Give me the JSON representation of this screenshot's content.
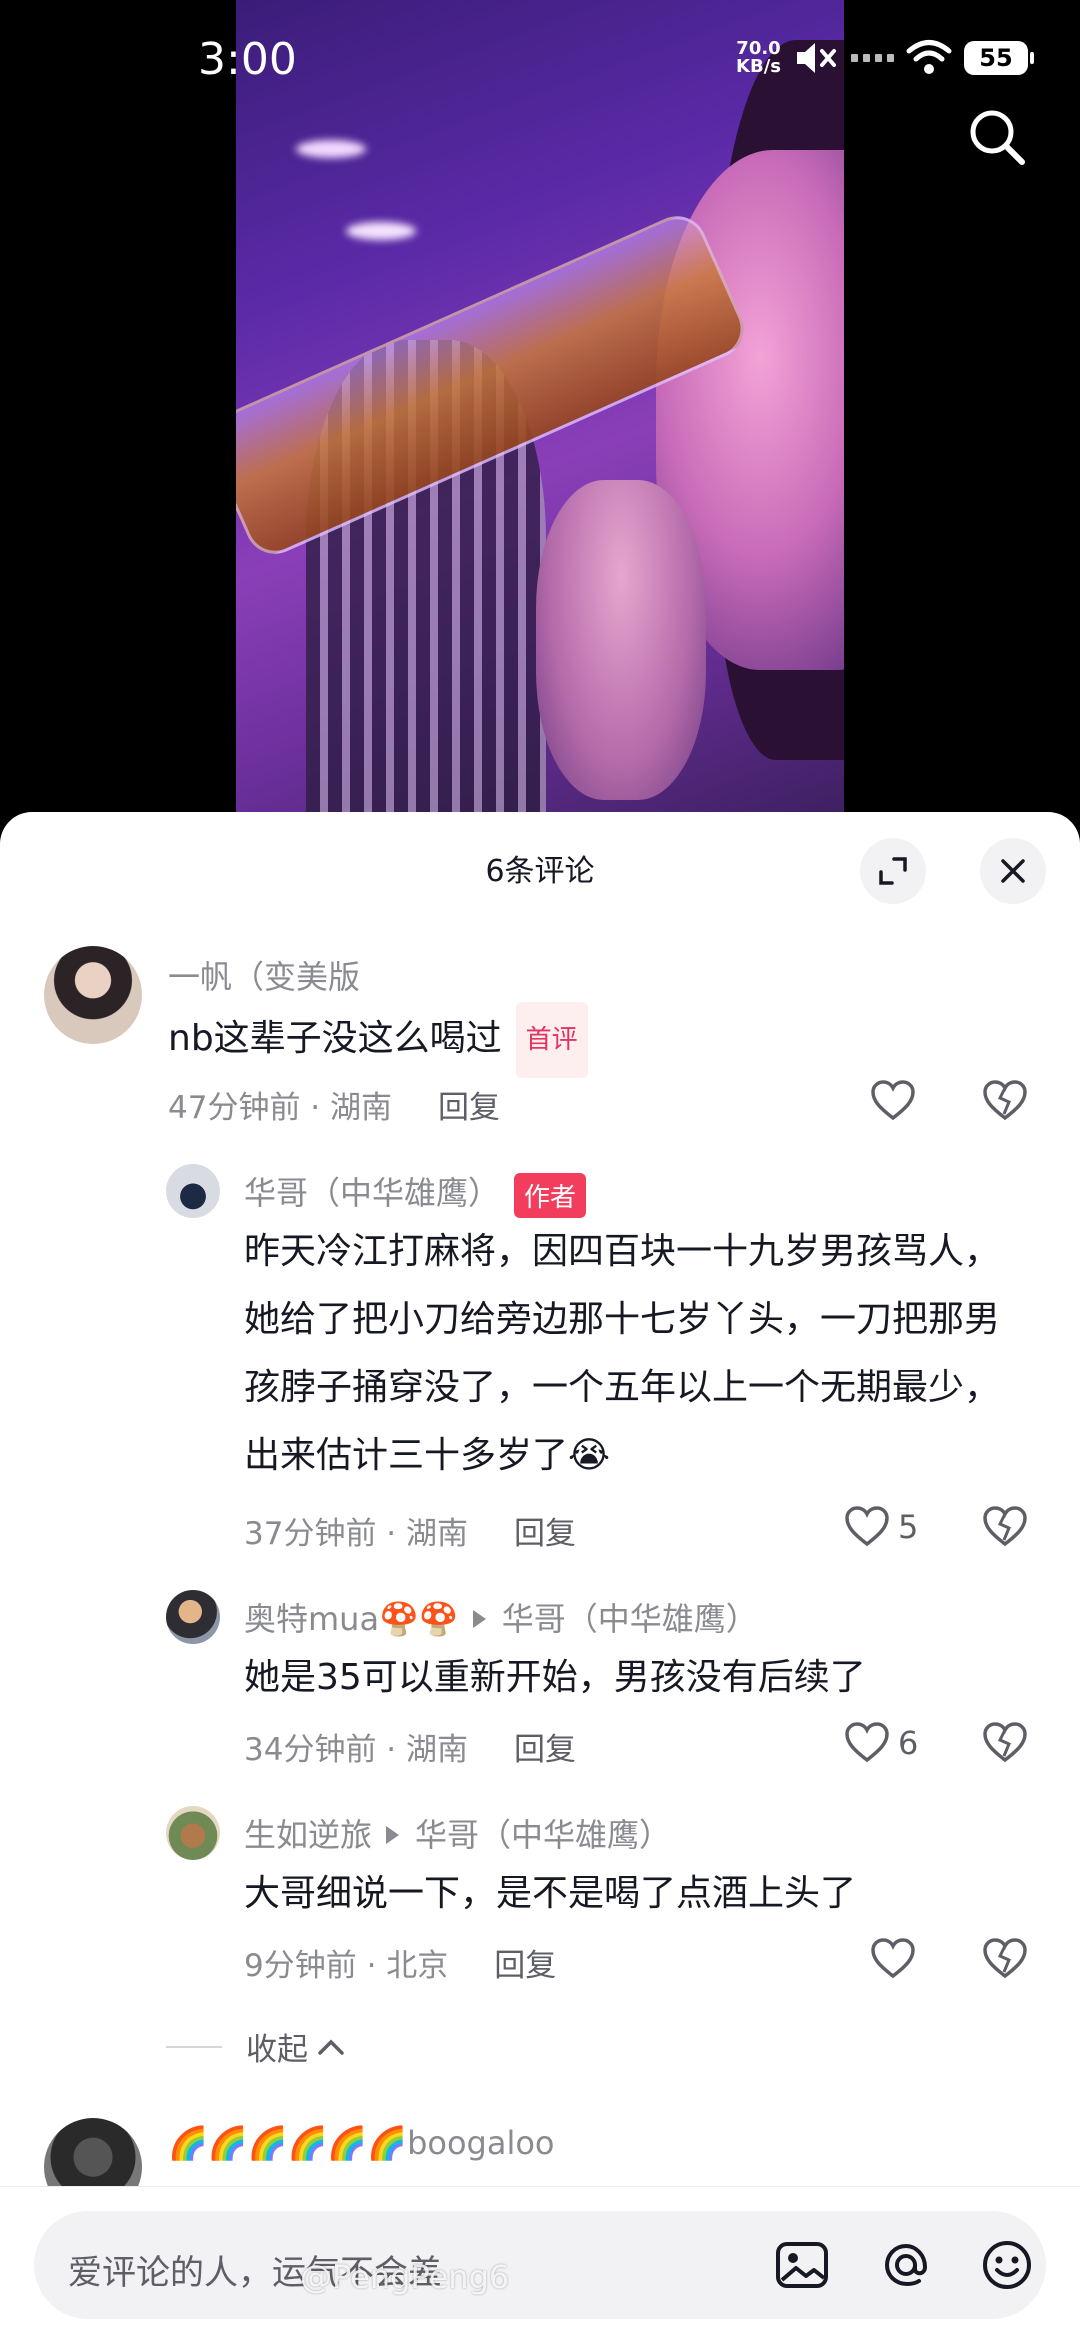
{
  "status_bar": {
    "time": "3:00",
    "net_speed_value": "70.0",
    "net_speed_unit": "KB/s",
    "battery": "55"
  },
  "sheet": {
    "title": "6条评论"
  },
  "comments": [
    {
      "name": "一帆（变美版",
      "text": "nb这辈子没这么喝过",
      "badge": "首评",
      "time": "47分钟前",
      "location": "湖南",
      "reply_label": "回复",
      "likes": ""
    },
    {
      "name": "华哥（中华雄鹰）",
      "badge": "作者",
      "text": "昨天冷江打麻将，因四百块一十九岁男孩骂人，她给了把小刀给旁边那十七岁丫头，一刀把那男孩脖子捅穿没了，一个五年以上一个无期最少，出来估计三十多岁了😭",
      "time": "37分钟前",
      "location": "湖南",
      "reply_label": "回复",
      "likes": "5"
    },
    {
      "name": "奥特mua🍄🍄",
      "reply_to": "华哥（中华雄鹰）",
      "text": "她是35可以重新开始，男孩没有后续了",
      "time": "34分钟前",
      "location": "湖南",
      "reply_label": "回复",
      "likes": "6"
    },
    {
      "name": "生如逆旅",
      "reply_to": "华哥（中华雄鹰）",
      "text": "大哥细说一下，是不是喝了点酒上头了",
      "time": "9分钟前",
      "location": "北京",
      "reply_label": "回复",
      "likes": ""
    }
  ],
  "collapse_label": "收起",
  "next_comment": {
    "name": "🌈🌈🌈🌈🌈🌈boogaloo"
  },
  "input": {
    "placeholder": "爱评论的人，运气不会差"
  },
  "watermark": "@PengPeng6"
}
